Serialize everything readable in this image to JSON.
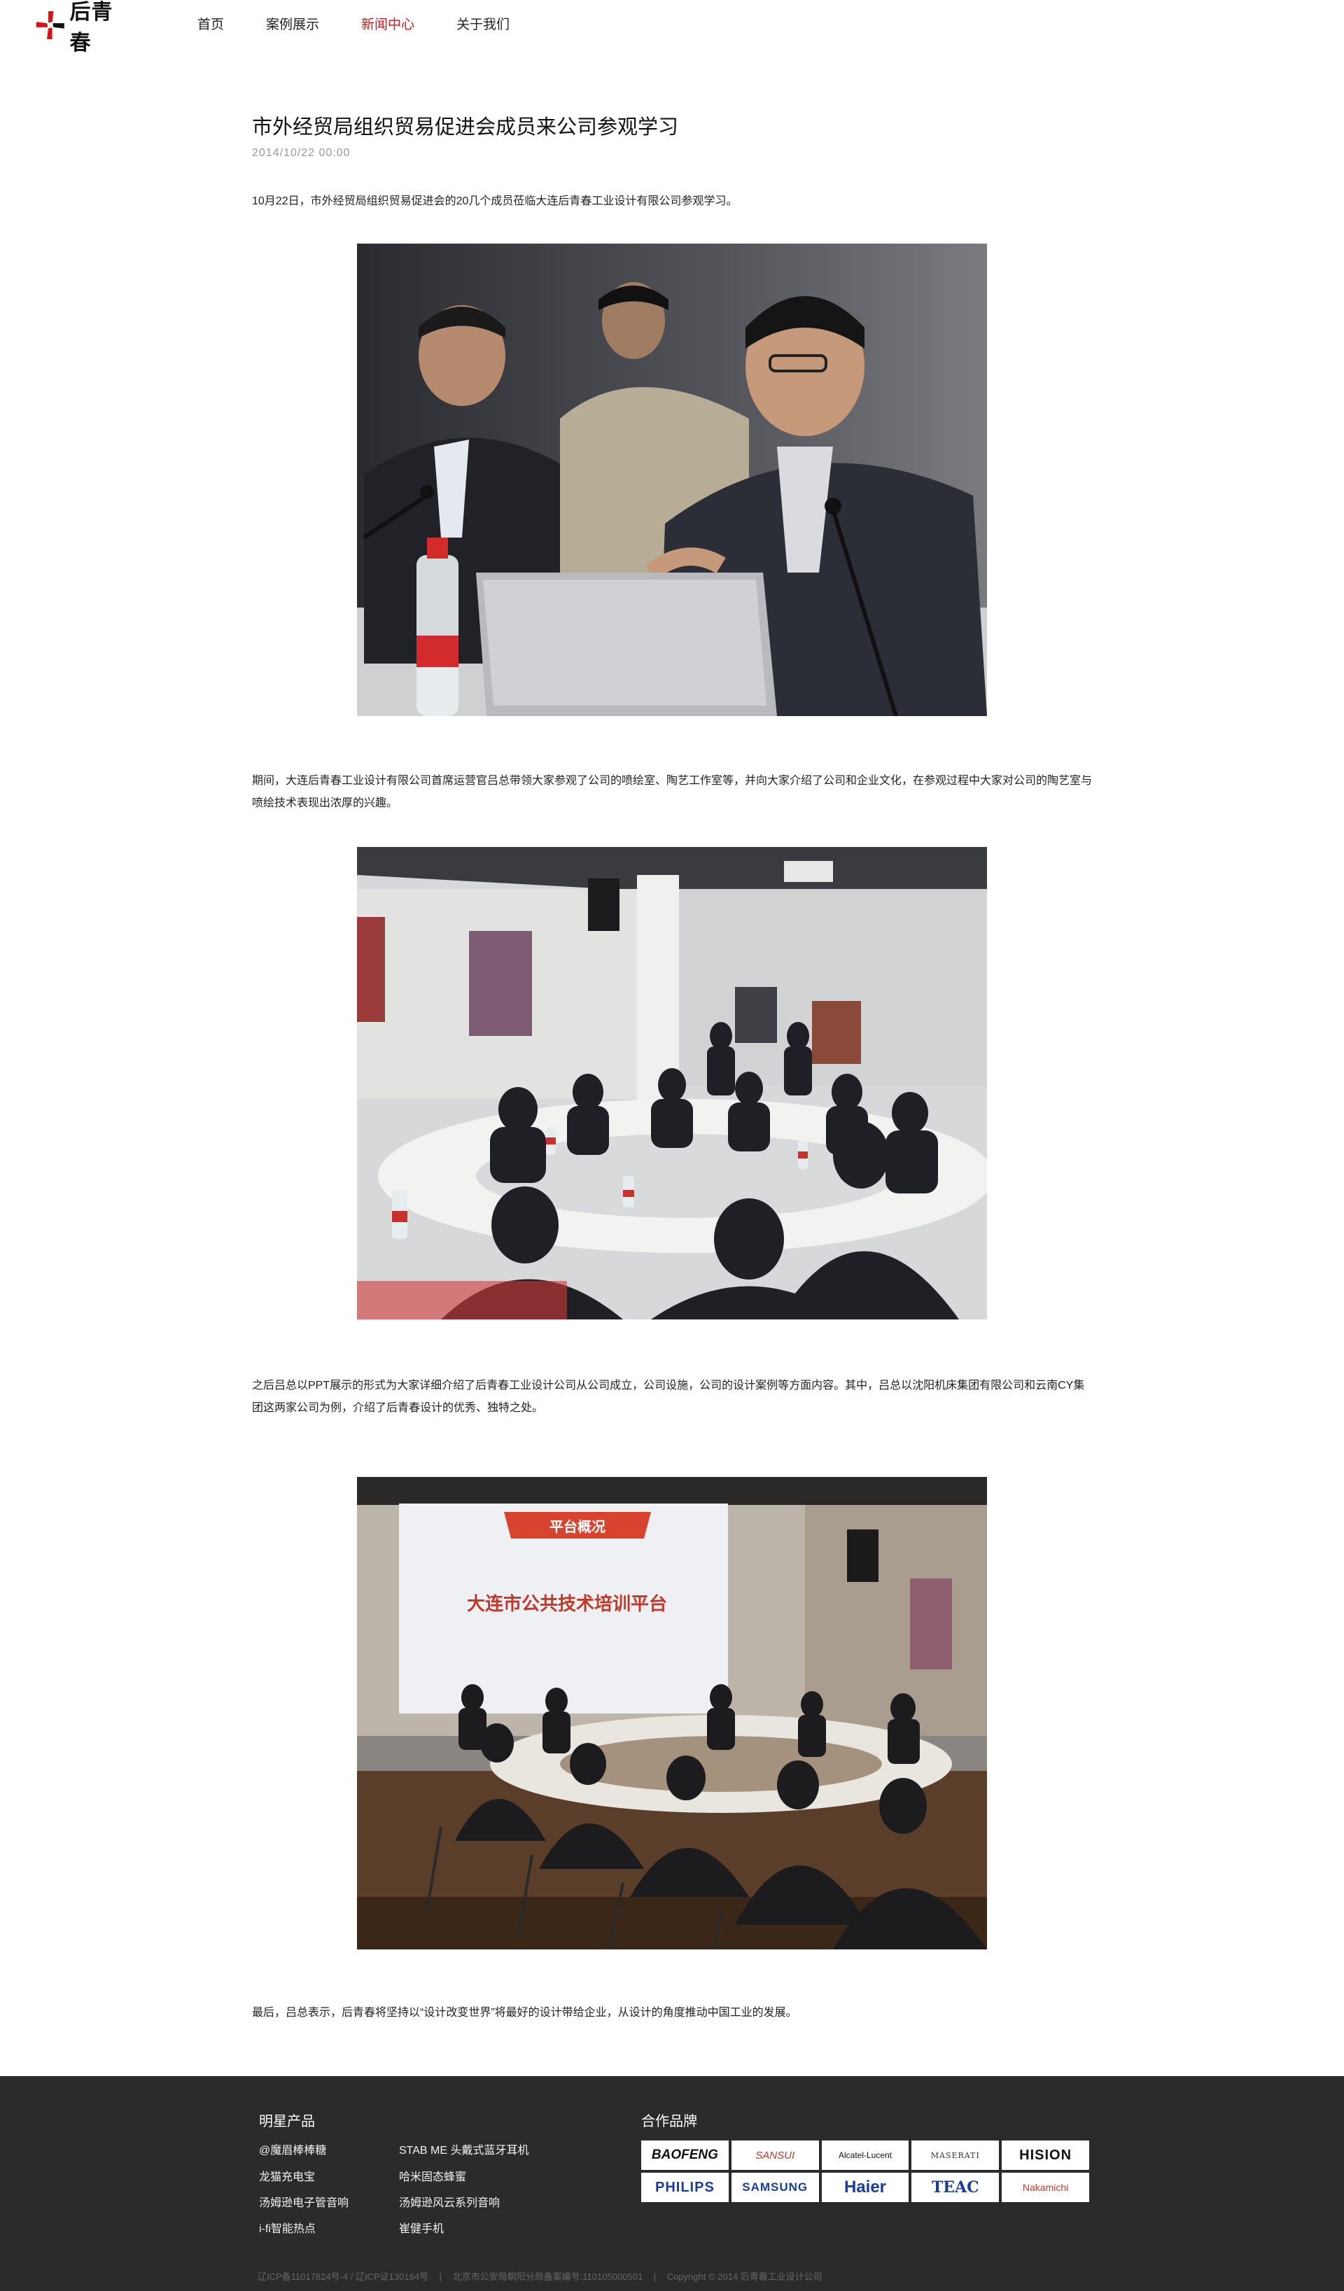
{
  "header": {
    "logo_text": "后青春",
    "nav": [
      {
        "label": "首页",
        "active": false
      },
      {
        "label": "案例展示",
        "active": false
      },
      {
        "label": "新闻中心",
        "active": true
      },
      {
        "label": "关于我们",
        "active": false
      }
    ]
  },
  "article": {
    "title": "市外经贸局组织贸易促进会成员来公司参观学习",
    "date": "2014/10/22  00:00",
    "paragraphs": [
      "10月22日，市外经贸局组织贸易促进会的20几个成员莅临大连后青春工业设计有限公司参观学习。",
      "期间，大连后青春工业设计有限公司首席运营官吕总带领大家参观了公司的喷绘室、陶艺工作室等，并向大家介绍了公司和企业文化，在参观过程中大家对公司的陶艺室与喷绘技术表现出浓厚的兴趣。",
      "之后吕总以PPT展示的形式为大家详细介绍了后青春工业设计公司从公司成立，公司设施，公司的设计案例等方面内容。其中，吕总以沈阳机床集团有限公司和云南CY集团这两家公司为例，介绍了后青春设计的优秀、独特之处。",
      "最后，吕总表示，后青春将坚持以“设计改变世界”将最好的设计带给企业，从设计的角度推动中国工业的发展。"
    ],
    "slide": {
      "banner": "平台概况",
      "headline": "大连市公共技术培训平台"
    }
  },
  "footer": {
    "products_heading": "明星产品",
    "products": [
      "@魔眉棒棒糖",
      "STAB ME 头戴式蓝牙耳机",
      "龙猫充电宝",
      "哈米固态蜂蜜",
      "汤姆逊电子管音响",
      "汤姆逊风云系列音响",
      "i-fi智能热点",
      "崔健手机"
    ],
    "brands_heading": "合作品牌",
    "brands": [
      "BAOFENG",
      "SANSUI",
      "Alcatel-Lucent",
      "MASERATI",
      "HISION",
      "PHILIPS",
      "SAMSUNG",
      "Haier",
      "TEAC",
      "Nakamichi"
    ],
    "copyright": [
      "辽ICP备11017824号-4 / 辽ICP证130164号",
      "|",
      "北京市公安局朝阳分局备案编号:110105000501",
      "|",
      "Copyright © 2014 后青春工业设计公司"
    ]
  },
  "colors": {
    "accent": "#d7141a",
    "footer_bg": "#2b2b2b"
  }
}
